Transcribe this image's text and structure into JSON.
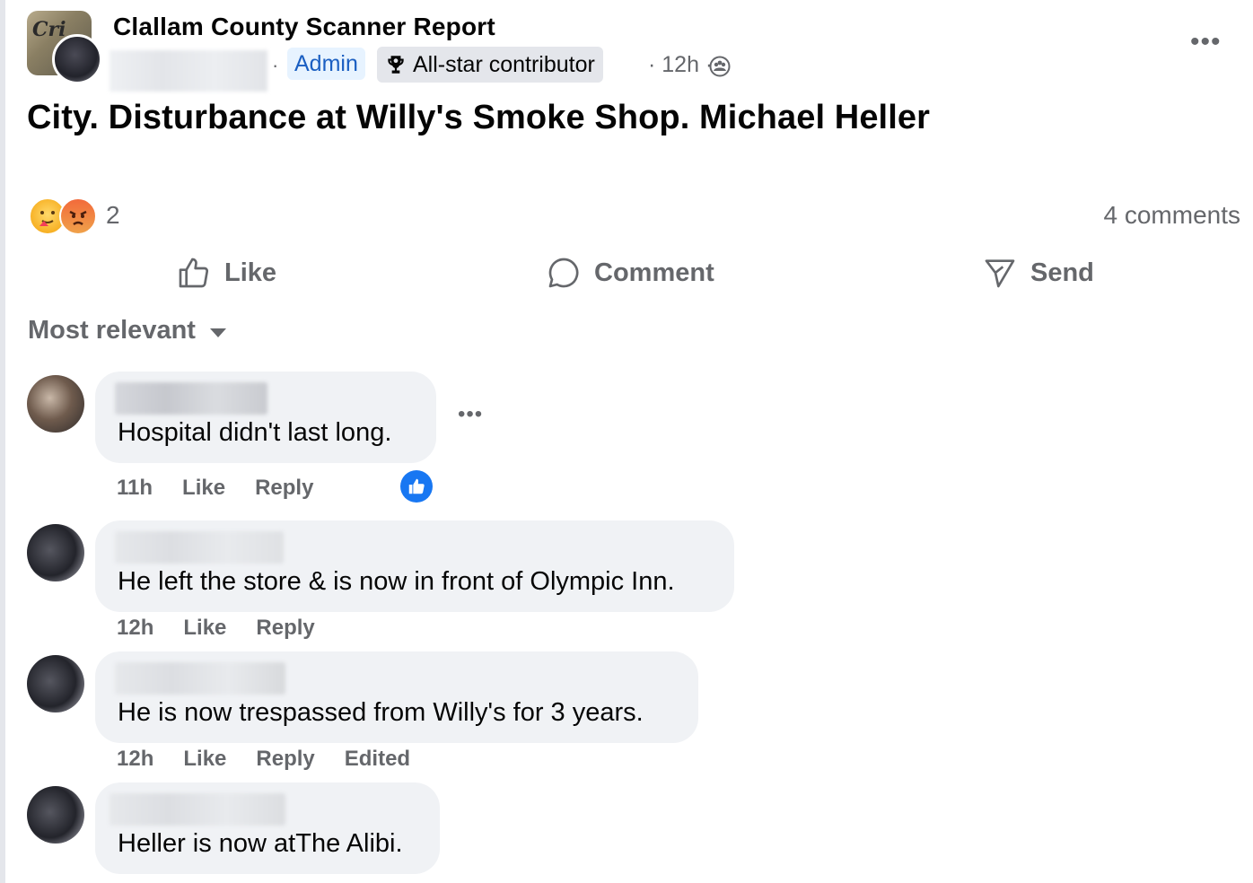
{
  "post": {
    "group_name": "Clallam County Scanner Report",
    "separator": "·",
    "admin_badge": "Admin",
    "allstar_badge": "All-star contributor",
    "time": "· 12h ·",
    "body": "City. Disturbance at Willy's Smoke Shop. Michael Heller",
    "more_icon": "more-horizontal-icon",
    "privacy_icon": "globe-icon"
  },
  "reactions": {
    "icons": [
      "care-reaction-icon",
      "angry-reaction-icon"
    ],
    "count": "2",
    "comments_count": "4 comments"
  },
  "actions": {
    "like": "Like",
    "comment": "Comment",
    "send": "Send"
  },
  "sort": {
    "label": "Most relevant"
  },
  "comments": [
    {
      "text": "Hospital didn't last long.",
      "time": "11h",
      "like": "Like",
      "reply": "Reply",
      "has_like_reaction": true
    },
    {
      "text": "He left the store & is now in front of Olympic Inn.",
      "time": "12h",
      "like": "Like",
      "reply": "Reply"
    },
    {
      "text": "He is now trespassed from Willy's for 3 years.",
      "time": "12h",
      "like": "Like",
      "reply": "Reply",
      "edited": "Edited"
    },
    {
      "text": "Heller is now atThe Alibi."
    }
  ],
  "colors": {
    "text_primary": "#050505",
    "text_secondary": "#65676b",
    "bubble_bg": "#f0f2f5",
    "admin_badge_bg": "#e7f3ff",
    "admin_badge_text": "#1b5fc2",
    "like_blue": "#1877f2"
  }
}
